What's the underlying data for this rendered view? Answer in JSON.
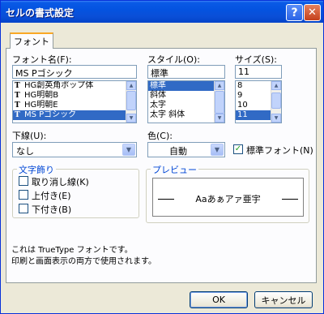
{
  "window": {
    "title": "セルの書式設定",
    "help_label": "?",
    "close_label": "✕"
  },
  "tabs": [
    {
      "label": "フォント",
      "active": true
    }
  ],
  "font_name": {
    "label": "フォント名(F):",
    "value": "MS Pゴシック",
    "items": [
      {
        "glyph": "T",
        "label": "HG創英角ポップ体",
        "selected": false
      },
      {
        "glyph": "T",
        "label": "HG明朝B",
        "selected": false
      },
      {
        "glyph": "T",
        "label": "HG明朝E",
        "selected": false
      },
      {
        "glyph": "T",
        "label": "MS Pゴシック",
        "selected": true
      }
    ]
  },
  "style": {
    "label": "スタイル(O):",
    "value": "標準",
    "items": [
      {
        "label": "標準",
        "selected": true
      },
      {
        "label": "斜体",
        "selected": false
      },
      {
        "label": "太字",
        "selected": false
      },
      {
        "label": "太字 斜体",
        "selected": false
      }
    ]
  },
  "size": {
    "label": "サイズ(S):",
    "value": "11",
    "items": [
      {
        "label": "8",
        "selected": false
      },
      {
        "label": "9",
        "selected": false
      },
      {
        "label": "10",
        "selected": false
      },
      {
        "label": "11",
        "selected": true
      }
    ]
  },
  "underline": {
    "label": "下線(U):",
    "value": "なし"
  },
  "color": {
    "label": "色(C):",
    "value": "自動"
  },
  "normal_font": {
    "label": "標準フォント(N)",
    "checked": true
  },
  "effects": {
    "title": "文字飾り",
    "options": [
      {
        "label": "取り消し線(K)",
        "checked": false
      },
      {
        "label": "上付き(E)",
        "checked": false
      },
      {
        "label": "下付き(B)",
        "checked": false
      }
    ]
  },
  "preview": {
    "title": "プレビュー",
    "sample": "Aaあぁアァ亜宇"
  },
  "description": {
    "line1": "これは TrueType フォントです。",
    "line2": "印刷と画面表示の両方で使用されます。"
  },
  "buttons": {
    "ok": "OK",
    "cancel": "キャンセル"
  },
  "colors": {
    "titlebar": "#0453e0",
    "selection": "#316ac5",
    "dialog_bg": "#ece9d8",
    "group_title": "#0046d5"
  }
}
